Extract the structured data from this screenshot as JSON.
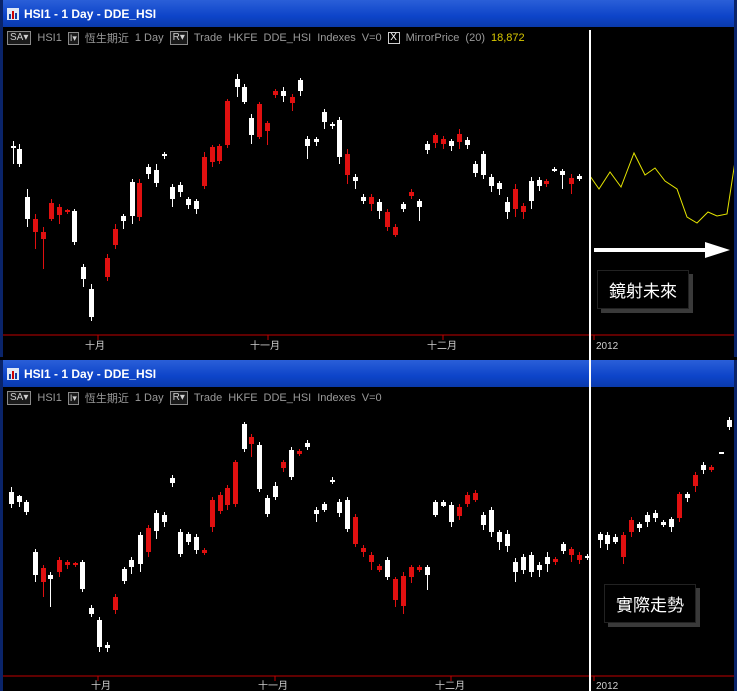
{
  "top": {
    "title": "HSI1 - 1 Day - DDE_HSI",
    "toolbar": {
      "sa": "SA",
      "symbol": "HSI1",
      "name": "恆生期近",
      "period": "1 Day",
      "r": "R",
      "trade": "Trade",
      "exchange": "HKFE",
      "source": "DDE_HSI",
      "type": "Indexes",
      "volume": "V=0",
      "mirror_check": "X",
      "mirror_label": "MirrorPrice",
      "mirror_period": "(20)",
      "mirror_value": "18,872"
    },
    "x_labels": [
      "十月",
      "十一月",
      "十二月",
      "2012"
    ],
    "callout": "鏡射未來"
  },
  "bottom": {
    "title": "HSI1 - 1 Day - DDE_HSI",
    "toolbar": {
      "sa": "SA",
      "symbol": "HSI1",
      "name": "恆生期近",
      "period": "1 Day",
      "r": "R",
      "trade": "Trade",
      "exchange": "HKFE",
      "source": "DDE_HSI",
      "type": "Indexes",
      "volume": "V=0"
    },
    "x_labels": [
      "十月",
      "十一月",
      "十二月",
      "2012"
    ],
    "callout": "實際走勢"
  },
  "colors": {
    "up": "#ffffff",
    "down": "#e01010",
    "mirror": "#e6e600",
    "axis": "#c00000"
  }
}
